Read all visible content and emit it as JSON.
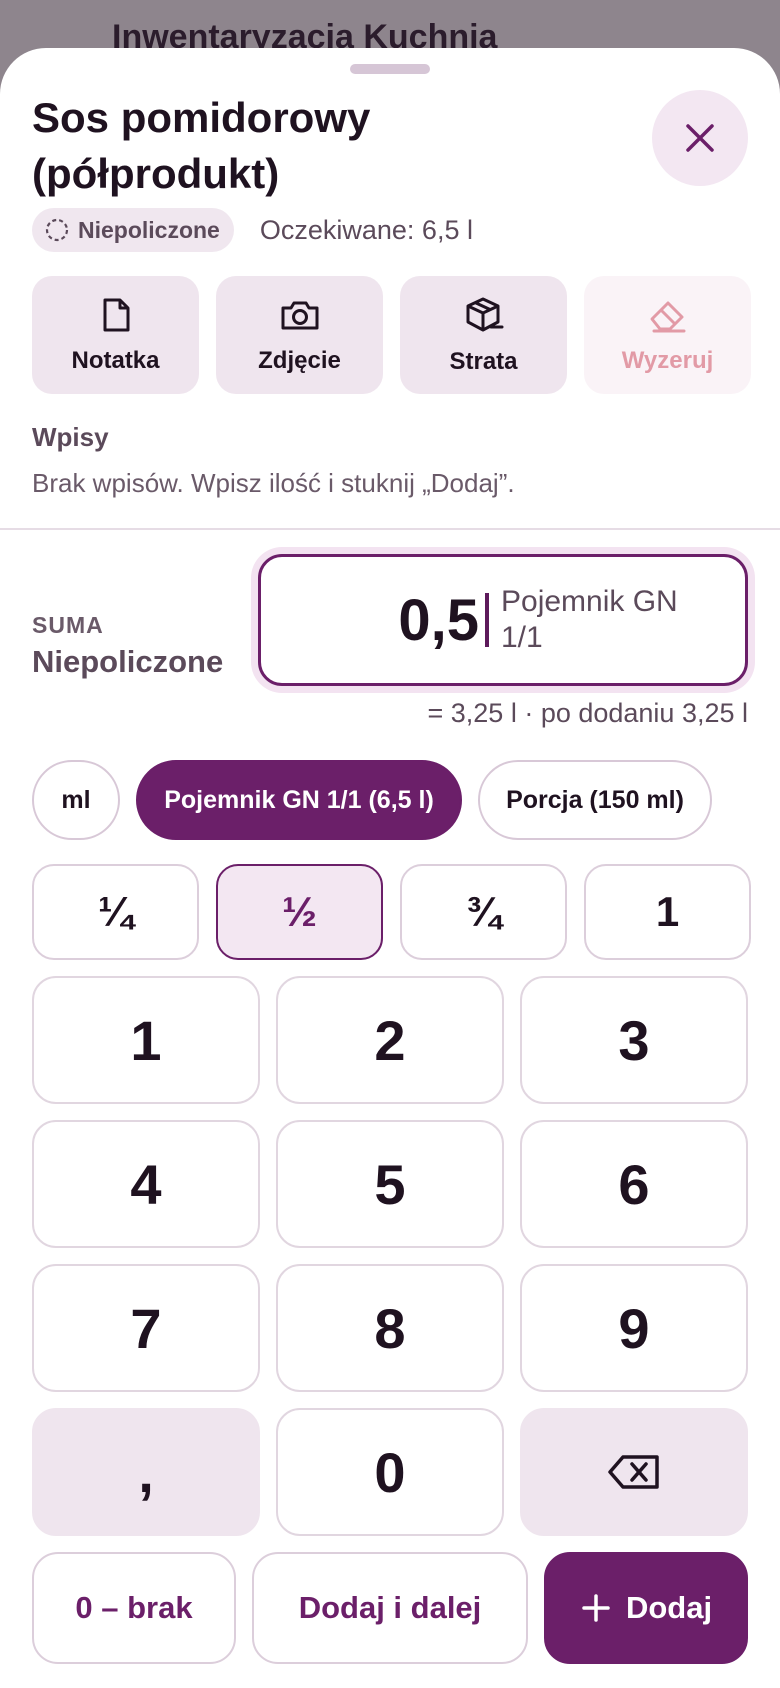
{
  "backdrop": {
    "title": "Inwentaryzacja Kuchnia"
  },
  "sheet": {
    "title": "Sos pomidorowy (półprodukt)",
    "status_badge": "Niepoliczone",
    "expected": "Oczekiwane: 6,5 l",
    "actions": [
      {
        "label": "Notatka",
        "icon": "note-icon"
      },
      {
        "label": "Zdjęcie",
        "icon": "camera-icon"
      },
      {
        "label": "Strata",
        "icon": "box-minus-icon"
      },
      {
        "label": "Wyzeruj",
        "icon": "eraser-icon",
        "disabled": true
      }
    ],
    "entries_title": "Wpisy",
    "entries_empty": "Brak wpisów. Wpisz ilość i stuknij „Dodaj”."
  },
  "quantity": {
    "sum_label": "SUMA",
    "sum_value": "Niepoliczone",
    "value": "0,5",
    "unit": "Pojemnik GN 1/1",
    "calc_line": "= 3,25 l · po dodaniu 3,25 l"
  },
  "units": [
    {
      "label": "ml",
      "selected": false
    },
    {
      "label": "Pojemnik GN 1/1 (6,5 l)",
      "selected": true
    },
    {
      "label": "Porcja (150 ml)",
      "selected": false
    }
  ],
  "fractions": [
    "¼",
    "½",
    "¾",
    "1"
  ],
  "selected_fraction": "½",
  "keypad": [
    "1",
    "2",
    "3",
    "4",
    "5",
    "6",
    "7",
    "8",
    "9",
    ",",
    "0"
  ],
  "bottom": {
    "zero_label": "0 – brak",
    "add_next_label": "Dodaj i dalej",
    "add_label": "Dodaj"
  },
  "colors": {
    "accent": "#6b1f69",
    "accent_light": "#f3e7f2",
    "reset_disabled": "#e29aa6",
    "text": "#1f1220"
  }
}
